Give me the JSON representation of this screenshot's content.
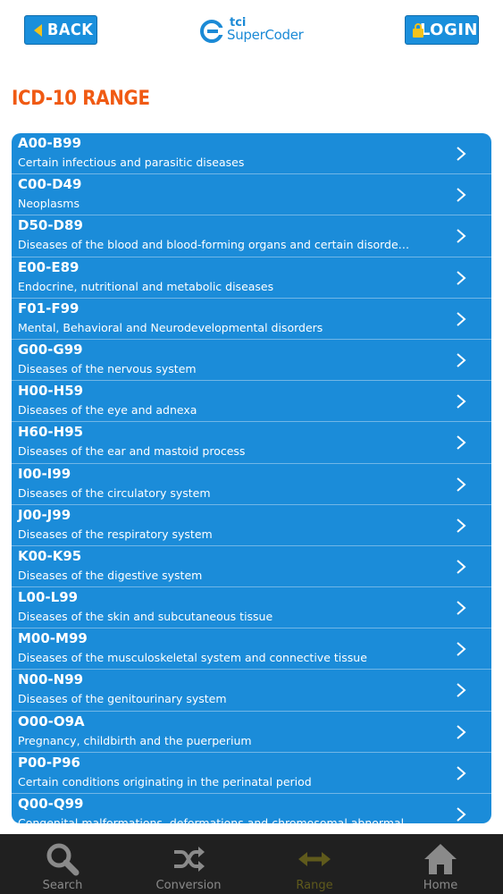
{
  "header": {
    "back_label": "BACK",
    "login_label": "LOGIN",
    "logo_tci": "tci",
    "logo_name": "SuperCoder"
  },
  "section_title": "ICD-10 RANGE",
  "ranges": [
    {
      "code": "A00-B99",
      "desc": "Certain infectious and parasitic diseases"
    },
    {
      "code": "C00-D49",
      "desc": "Neoplasms"
    },
    {
      "code": "D50-D89",
      "desc": "Diseases of the blood and blood-forming organs and certain disorder..."
    },
    {
      "code": "E00-E89",
      "desc": "Endocrine, nutritional and metabolic diseases"
    },
    {
      "code": "F01-F99",
      "desc": "Mental, Behavioral and Neurodevelopmental disorders"
    },
    {
      "code": "G00-G99",
      "desc": "Diseases of the nervous system"
    },
    {
      "code": "H00-H59",
      "desc": "Diseases of the eye and adnexa"
    },
    {
      "code": "H60-H95",
      "desc": "Diseases of the ear and mastoid process"
    },
    {
      "code": "I00-I99",
      "desc": "Diseases of the circulatory system"
    },
    {
      "code": "J00-J99",
      "desc": "Diseases of the respiratory system"
    },
    {
      "code": "K00-K95",
      "desc": "Diseases of the digestive system"
    },
    {
      "code": "L00-L99",
      "desc": "Diseases of the skin and subcutaneous tissue"
    },
    {
      "code": "M00-M99",
      "desc": "Diseases of the musculoskeletal system and connective tissue"
    },
    {
      "code": "N00-N99",
      "desc": "Diseases of the genitourinary system"
    },
    {
      "code": "O00-O9A",
      "desc": "Pregnancy, childbirth and the puerperium"
    },
    {
      "code": "P00-P96",
      "desc": "Certain conditions originating in the perinatal period"
    },
    {
      "code": "Q00-Q99",
      "desc": "Congenital malformations, deformations and chromosomal abnormal"
    }
  ],
  "tabbar": {
    "tabs": [
      {
        "label": "Search",
        "icon": "search-icon"
      },
      {
        "label": "Conversion",
        "icon": "shuffle-icon"
      },
      {
        "label": "Range",
        "icon": "range-arrows-icon",
        "active": true
      },
      {
        "label": "Home",
        "icon": "home-icon"
      }
    ]
  },
  "colors": {
    "accent": "#1b8cd9",
    "title": "#f05a13",
    "button_icon": "#f3c21c",
    "tabbar_bg": "#202020",
    "active_tab": "#5f5a1c"
  }
}
